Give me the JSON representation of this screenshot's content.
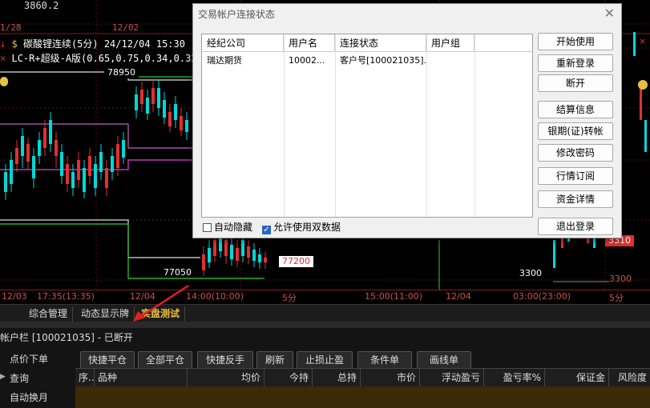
{
  "chart": {
    "price_top": "3860.2",
    "date_left": "1/28",
    "date_mid": "12/02",
    "symbol_line": "碳酸锂连续(5分) 24/12/04 15:30",
    "indicator_line": "LC-R+超级-A版(0.65,0.75,0.34,0.32",
    "level_high": "78950",
    "level_low": "77050",
    "current_price": "77200",
    "right_price_1": "3310",
    "right_price_2": "3300",
    "right_price_3": "3300",
    "time_labels": [
      "12/03",
      "17:35(13:35)",
      "12/04",
      "14:00(10:00)",
      "5分",
      "15:00(11:00)",
      "12/04",
      "03:00(23:00)",
      "5分"
    ]
  },
  "tabs": [
    "综合管理",
    "动态显示牌",
    "实盘测试"
  ],
  "account": {
    "title": "帐户栏 [100021035]  - 已断开"
  },
  "left_nav": [
    "点价下单",
    "查询",
    "自动换月"
  ],
  "toolbar": [
    "快捷平仓",
    "全部平仓",
    "快捷反手",
    "刷新",
    "止损止盈",
    "条件单",
    "画线单"
  ],
  "grid_columns": [
    "序..",
    "品种",
    "均价",
    "今持",
    "总持",
    "市价",
    "浮动盈亏",
    "盈亏率%",
    "保证金",
    "风险度"
  ],
  "dialog": {
    "title": "交易帐户连接状态",
    "close": "✕",
    "columns": [
      "经纪公司",
      "用户名",
      "连接状态",
      "用户组"
    ],
    "rows": [
      {
        "broker": "瑞达期货",
        "user": "10002...",
        "status": "客户号[100021035]...",
        "group": ""
      }
    ],
    "buttons": [
      "开始使用",
      "重新登录",
      "断开",
      "结算信息",
      "银期(证)转帐",
      "修改密码",
      "行情订阅",
      "资金详情",
      "退出登录"
    ],
    "auto_hide_label": "自动隐藏",
    "auto_hide_checked": false,
    "dual_data_label": "允许使用双数据",
    "dual_data_checked": true
  },
  "colors": {
    "up": "#00d8d8",
    "down": "#e03030",
    "axis": "#c85050",
    "accent": "#e8c040"
  }
}
